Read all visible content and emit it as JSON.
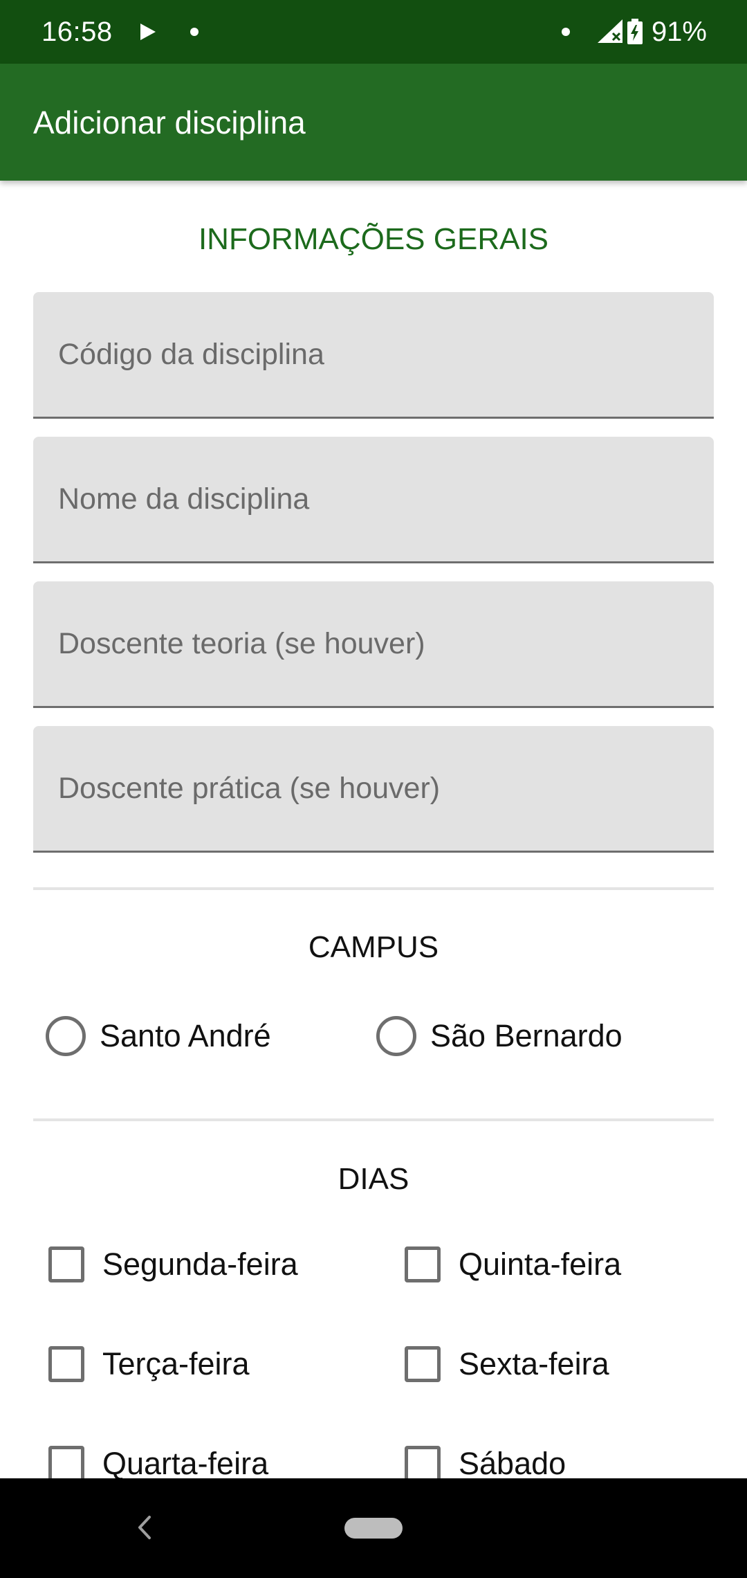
{
  "status_bar": {
    "time": "16:58",
    "battery": "91%"
  },
  "app_bar": {
    "title": "Adicionar disciplina"
  },
  "general_info": {
    "title": "INFORMAÇÕES GERAIS",
    "fields": [
      {
        "placeholder": "Código da disciplina",
        "value": ""
      },
      {
        "placeholder": "Nome da disciplina",
        "value": ""
      },
      {
        "placeholder": "Doscente teoria (se houver)",
        "value": ""
      },
      {
        "placeholder": "Doscente prática (se houver)",
        "value": ""
      }
    ]
  },
  "campus": {
    "title": "CAMPUS",
    "options": [
      {
        "label": "Santo André",
        "selected": false
      },
      {
        "label": "São Bernardo",
        "selected": false
      }
    ]
  },
  "days": {
    "title": "DIAS",
    "options": [
      {
        "label": "Segunda-feira",
        "checked": false
      },
      {
        "label": "Quinta-feira",
        "checked": false
      },
      {
        "label": "Terça-feira",
        "checked": false
      },
      {
        "label": "Sexta-feira",
        "checked": false
      },
      {
        "label": "Quarta-feira",
        "checked": false
      },
      {
        "label": "Sábado",
        "checked": false
      }
    ]
  },
  "colors": {
    "status_bar": "#124F10",
    "app_bar": "#236B23",
    "accent_title": "#1C6A1C",
    "field_background": "#E2E2E2"
  },
  "icons": {
    "status_left": [
      "play-icon",
      "notification-dot-icon"
    ],
    "status_right": [
      "notification-dot-icon",
      "signal-icon",
      "battery-charging-icon"
    ],
    "navigation": [
      "back-icon",
      "home-pill"
    ]
  }
}
